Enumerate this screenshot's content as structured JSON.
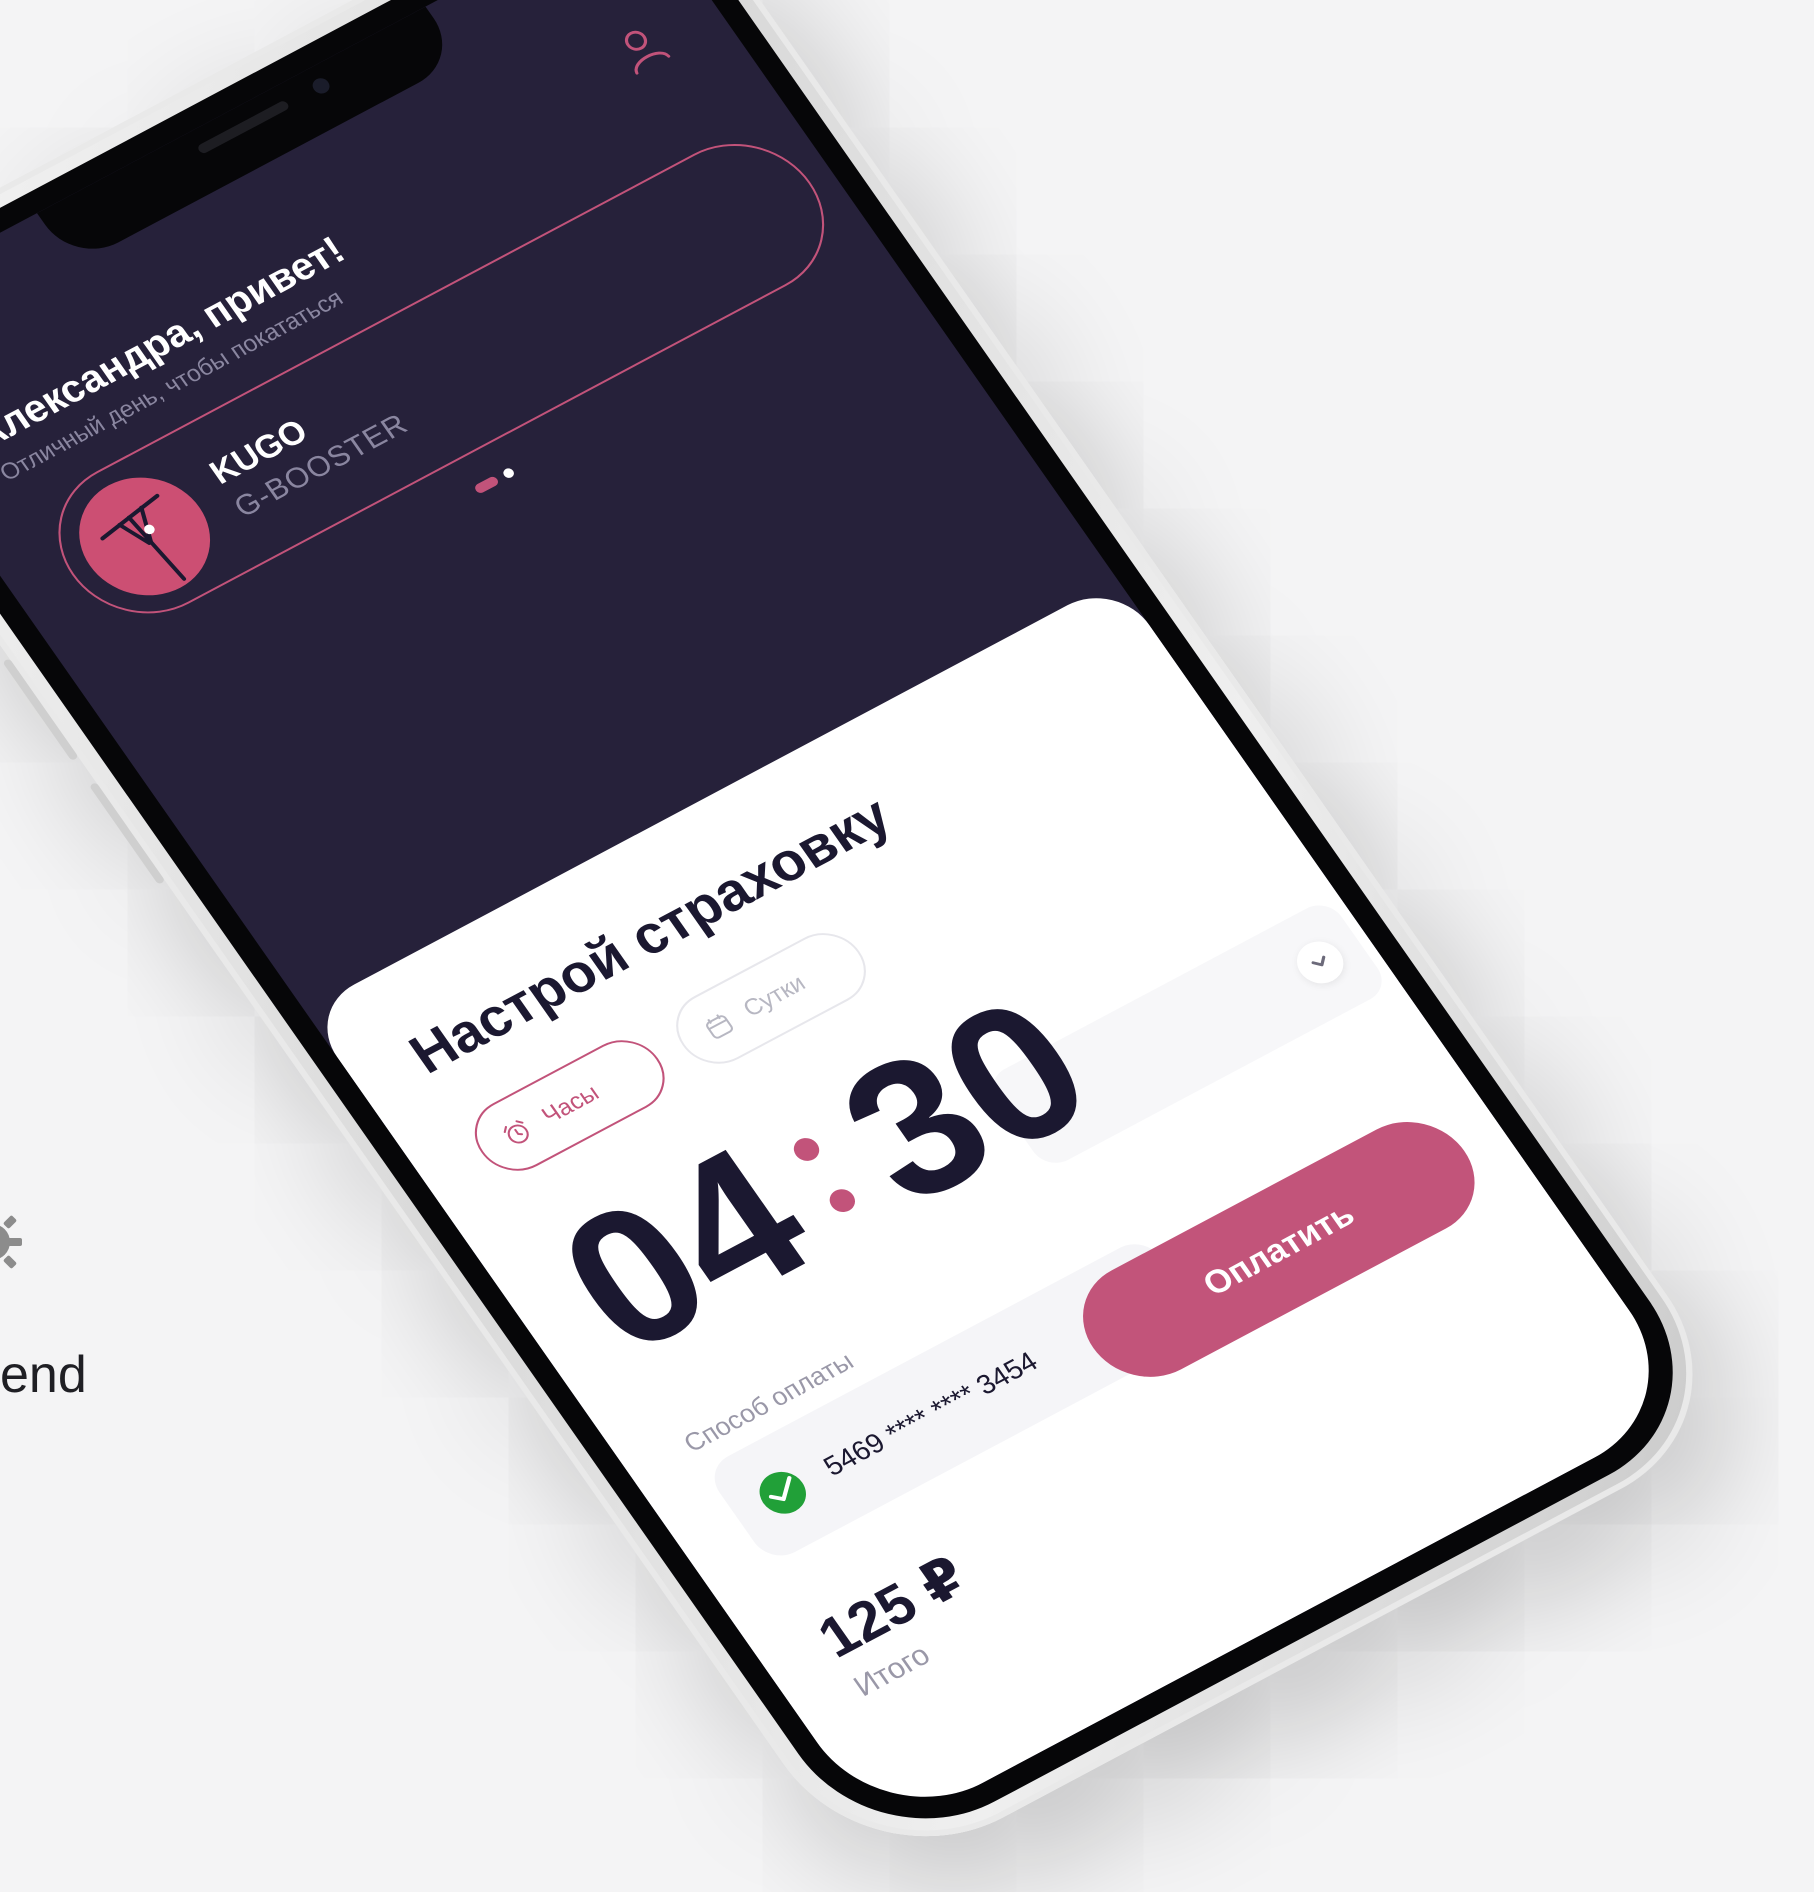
{
  "edge": {
    "partial_text": "end",
    "icon": "gear-icon"
  },
  "header": {
    "greeting": "Александра, привет!",
    "subtitle": "Отличный день, чтобы покататься",
    "profile_icon": "user-icon"
  },
  "vehicle": {
    "brand": "KUGO",
    "model": "G-BOOSTER",
    "icon": "scooter-icon"
  },
  "carousel": {
    "page_count": 2,
    "active_index": 0
  },
  "insurance": {
    "title": "Настрой страховку",
    "tabs": [
      {
        "label": "Часы",
        "icon": "alarm-clock-icon",
        "selected": true
      },
      {
        "label": "Сутки",
        "icon": "calendar-icon",
        "selected": false
      }
    ],
    "time": {
      "hours": "04",
      "minutes": "30"
    },
    "payment": {
      "label": "Способ оплаты",
      "card_number": "5469 **** **** 3454",
      "bank_icon": "sberbank-icon"
    },
    "pay_button": "Оплатить",
    "total": {
      "amount": "125 ₽",
      "label": "Итого"
    }
  },
  "colors": {
    "accent": "#c2537a",
    "screen_bg": "#26213a",
    "sheet_bg": "#ffffff",
    "text_dark": "#1b1830",
    "text_muted": "#8a86a0"
  }
}
